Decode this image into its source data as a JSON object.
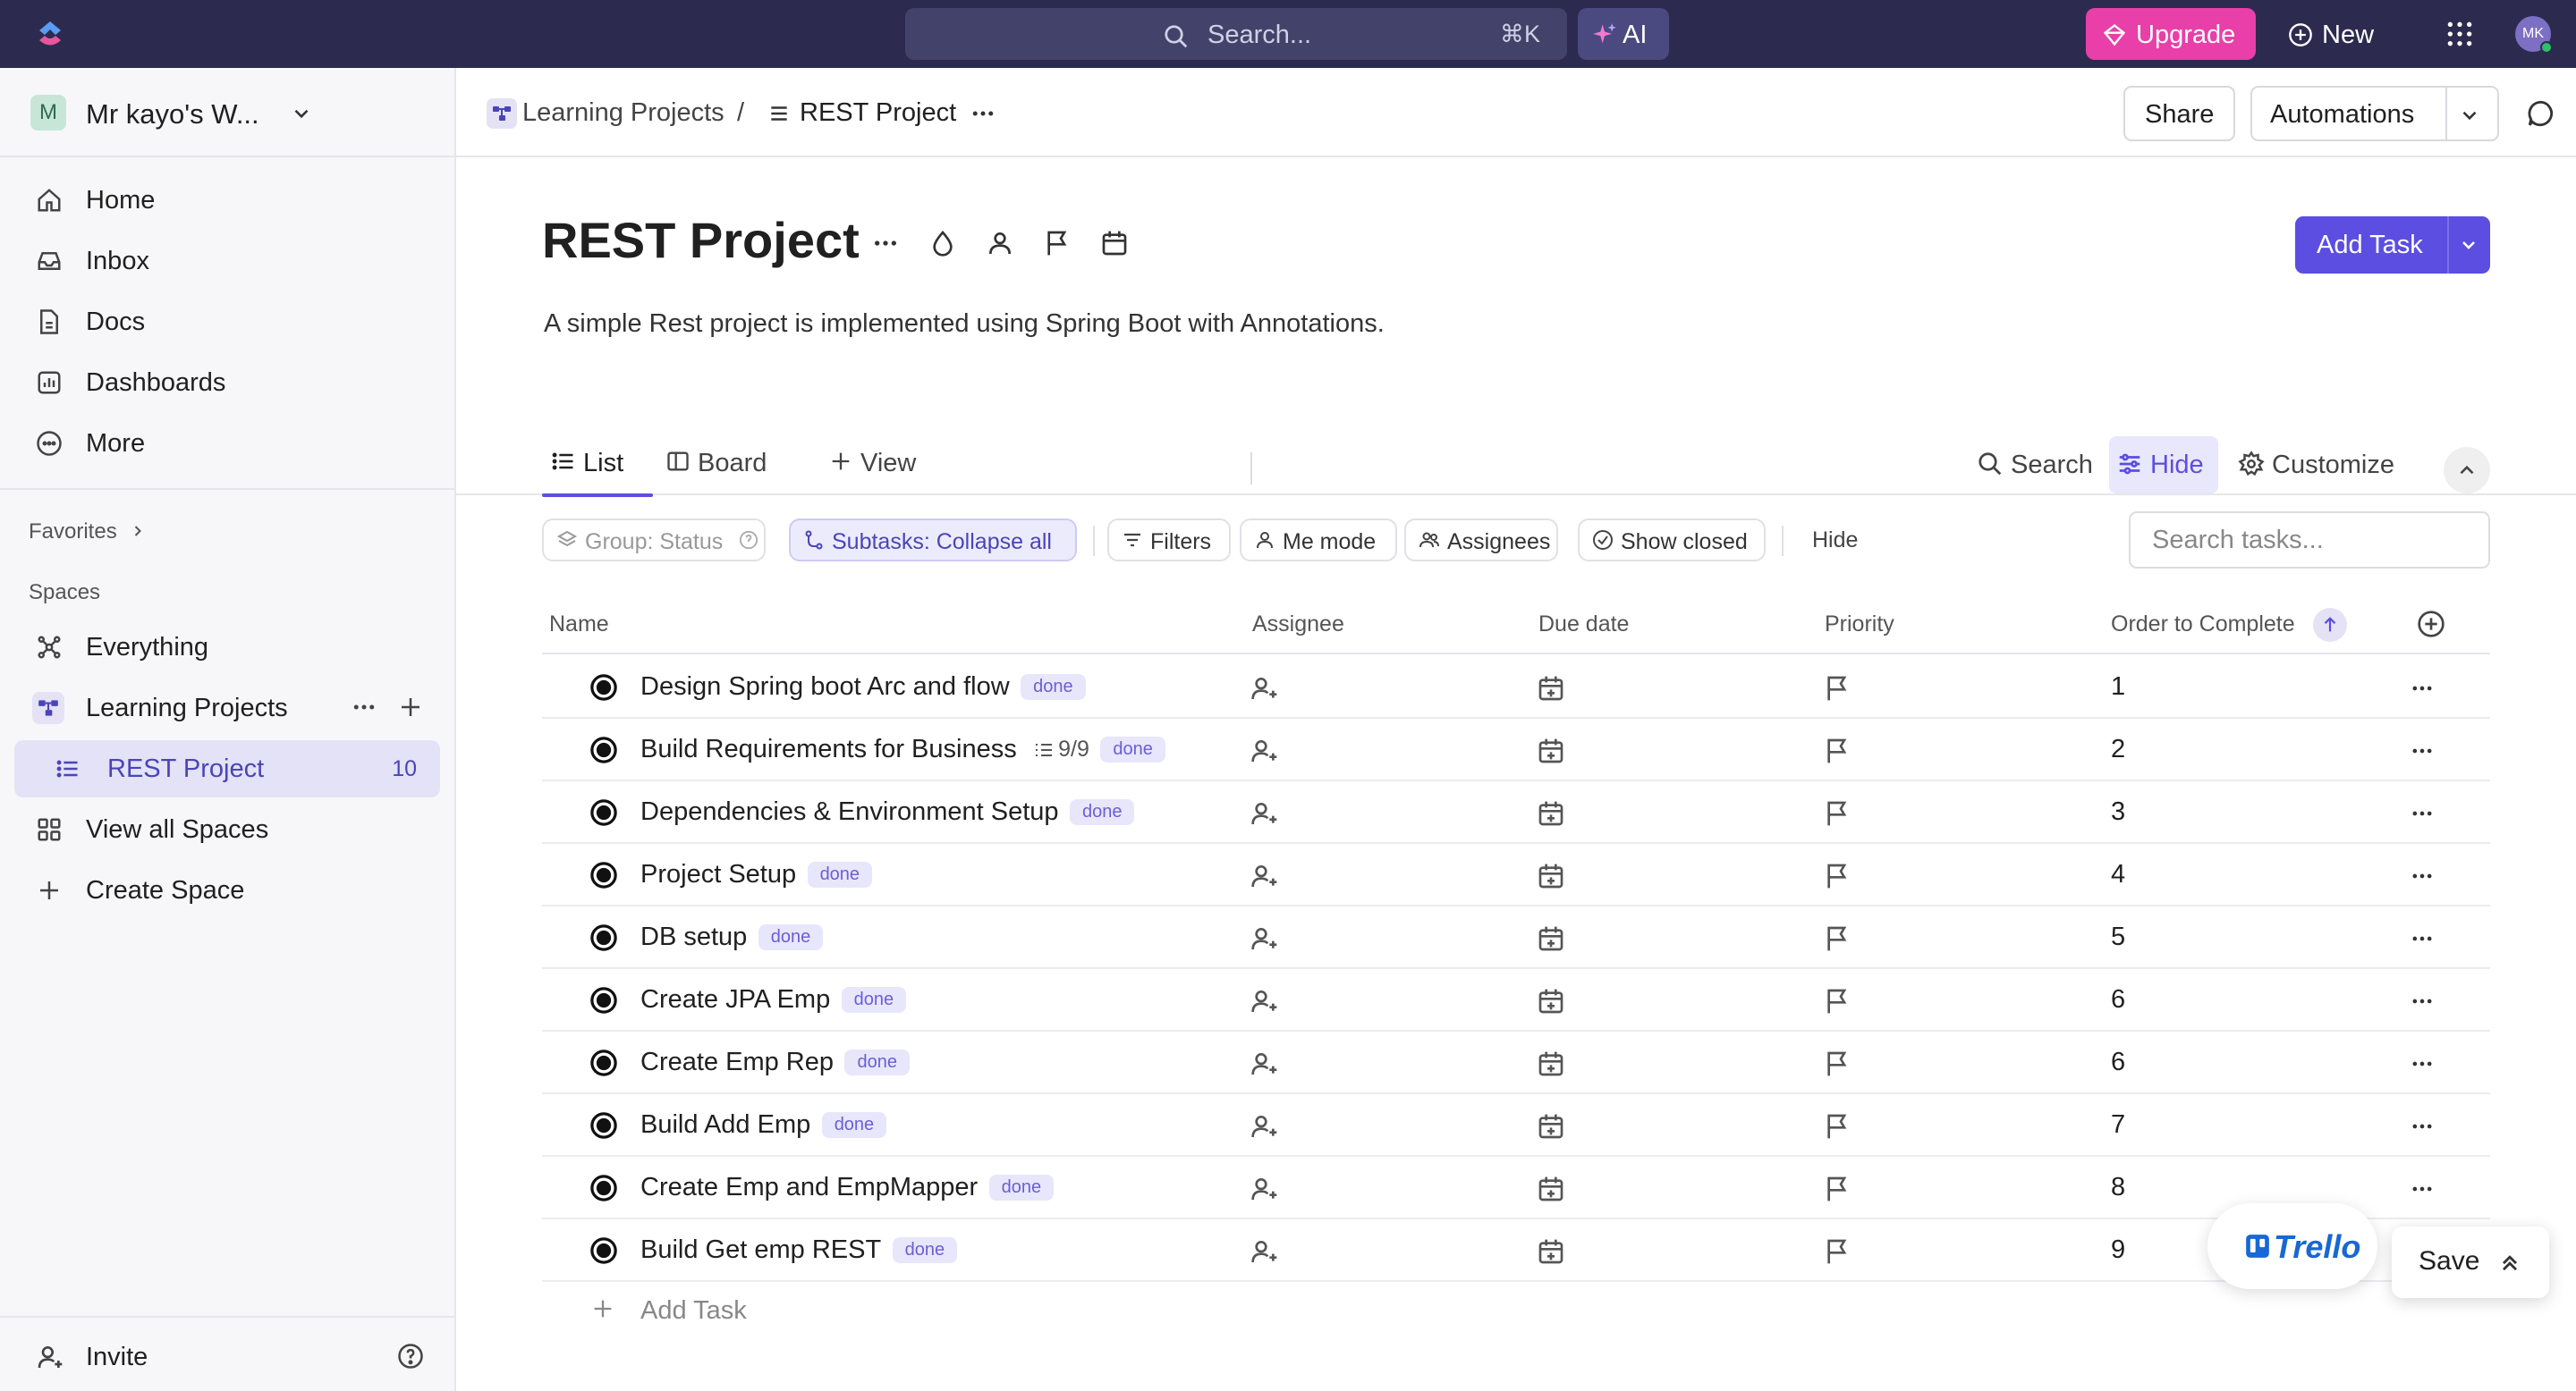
{
  "topbar": {
    "search_placeholder": "Search...",
    "search_shortcut": "⌘K",
    "ai_label": "AI",
    "upgrade_label": "Upgrade",
    "new_label": "New",
    "user_initials": "MK"
  },
  "sidebar": {
    "workspace_initial": "M",
    "workspace_name": "Mr kayo's W...",
    "nav": [
      {
        "label": "Home",
        "icon": "home-icon"
      },
      {
        "label": "Inbox",
        "icon": "inbox-icon"
      },
      {
        "label": "Docs",
        "icon": "docs-icon"
      },
      {
        "label": "Dashboards",
        "icon": "dashboards-icon"
      },
      {
        "label": "More",
        "icon": "more-icon"
      }
    ],
    "favorites_label": "Favorites",
    "spaces_label": "Spaces",
    "everything_label": "Everything",
    "space_name": "Learning Projects",
    "list_name": "REST Project",
    "list_count": "10",
    "view_all_spaces": "View all Spaces",
    "create_space": "Create Space",
    "invite_label": "Invite"
  },
  "header": {
    "crumb_space": "Learning Projects",
    "crumb_separator": "/",
    "crumb_list": "REST Project",
    "share_label": "Share",
    "automations_label": "Automations"
  },
  "page": {
    "title": "REST Project",
    "description": "A simple Rest project is implemented using Spring Boot with Annotations.",
    "add_task_label": "Add Task"
  },
  "views": {
    "tabs": [
      "List",
      "Board",
      "View"
    ],
    "search_label": "Search",
    "hide_label": "Hide",
    "customize_label": "Customize"
  },
  "filters": {
    "group_label": "Group: Status",
    "subtasks_label": "Subtasks: Collapse all",
    "filters_label": "Filters",
    "me_mode_label": "Me mode",
    "assignees_label": "Assignees",
    "show_closed_label": "Show closed",
    "hide_label": "Hide",
    "search_placeholder": "Search tasks..."
  },
  "table": {
    "columns": [
      "Name",
      "Assignee",
      "Due date",
      "Priority",
      "Order to Complete"
    ],
    "rows": [
      {
        "name": "Design Spring boot Arc and flow",
        "subtasks": "",
        "status": "done",
        "order": "1"
      },
      {
        "name": "Build Requirements for Business",
        "subtasks": "9/9",
        "status": "done",
        "order": "2"
      },
      {
        "name": "Dependencies & Environment Setup",
        "subtasks": "",
        "status": "done",
        "order": "3"
      },
      {
        "name": "Project Setup",
        "subtasks": "",
        "status": "done",
        "order": "4"
      },
      {
        "name": "DB setup",
        "subtasks": "",
        "status": "done",
        "order": "5"
      },
      {
        "name": "Create JPA Emp",
        "subtasks": "",
        "status": "done",
        "order": "6"
      },
      {
        "name": "Create Emp Rep",
        "subtasks": "",
        "status": "done",
        "order": "6"
      },
      {
        "name": "Build Add Emp",
        "subtasks": "",
        "status": "done",
        "order": "7"
      },
      {
        "name": "Create Emp and EmpMapper",
        "subtasks": "",
        "status": "done",
        "order": "8"
      },
      {
        "name": "Build Get emp REST",
        "subtasks": "",
        "status": "done",
        "order": "9"
      }
    ],
    "add_task_label": "Add Task"
  },
  "floating": {
    "trello_label": "Trello",
    "save_label": "Save"
  },
  "colors": {
    "topbar": "#2c2b4f",
    "accent": "#5b4ee0",
    "upgrade": "#e83fa8",
    "tag_bg": "#e8e6fb",
    "tag_text": "#6a5fd6"
  }
}
